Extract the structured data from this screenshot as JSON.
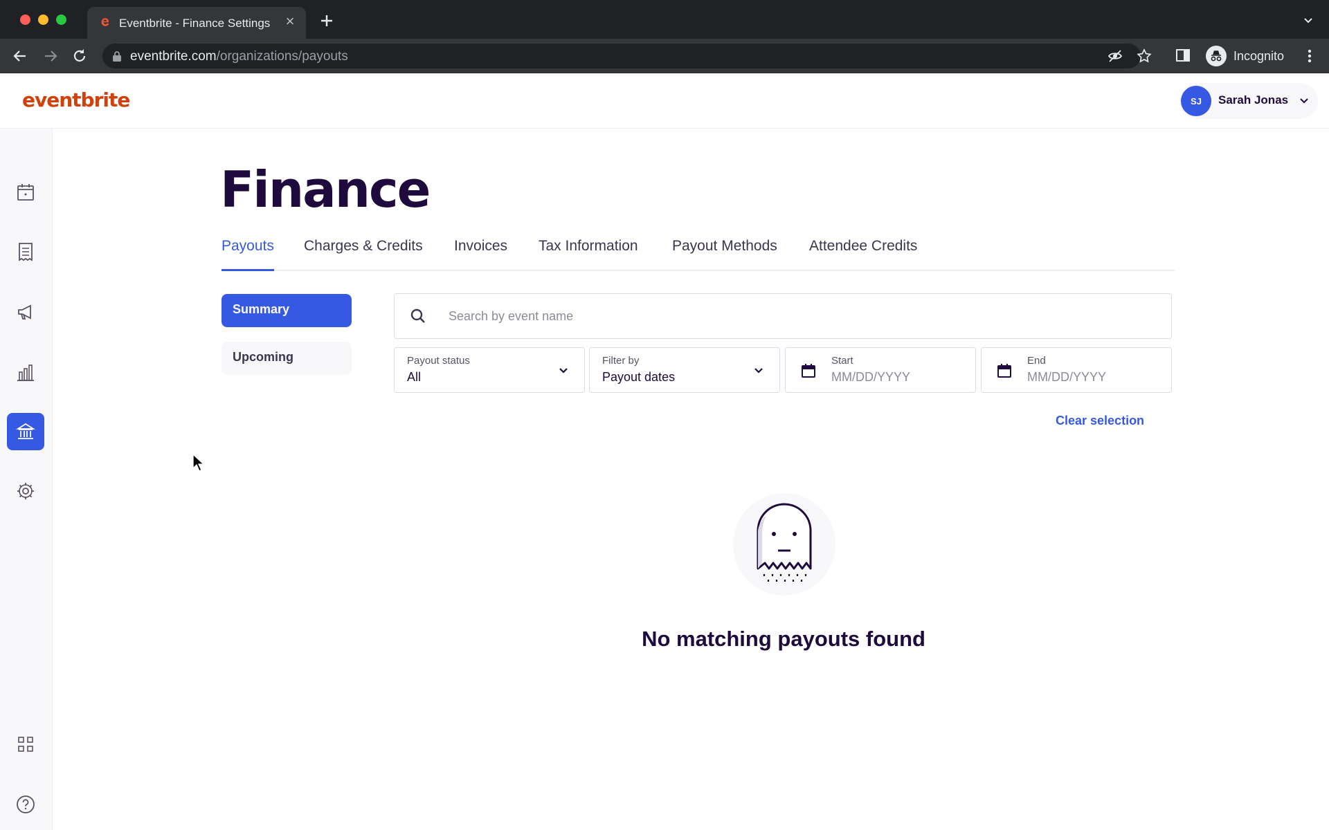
{
  "browser": {
    "tab_title": "Eventbrite - Finance Settings",
    "url_domain": "eventbrite.com",
    "url_path": "/organizations/payouts",
    "profile_label": "Incognito"
  },
  "header": {
    "logo": "eventbrite",
    "user_initials": "SJ",
    "user_name": "Sarah Jonas"
  },
  "sidebar": {
    "items": [
      {
        "icon": "calendar-icon",
        "active": false
      },
      {
        "icon": "orders-list-icon",
        "active": false
      },
      {
        "icon": "megaphone-icon",
        "active": false
      },
      {
        "icon": "bar-chart-icon",
        "active": false
      },
      {
        "icon": "bank-icon",
        "active": true
      },
      {
        "icon": "gear-icon",
        "active": false
      },
      {
        "icon": "apps-grid-icon",
        "active": false
      },
      {
        "icon": "help-icon",
        "active": false
      }
    ]
  },
  "page": {
    "title": "Finance",
    "tabs": [
      "Payouts",
      "Charges & Credits",
      "Invoices",
      "Tax Information",
      "Payout Methods",
      "Attendee Credits"
    ],
    "active_tab": "Payouts",
    "side_nav": [
      "Summary",
      "Upcoming"
    ],
    "search_placeholder": "Search by event name",
    "filters": {
      "payout_status": {
        "label": "Payout status",
        "value": "All"
      },
      "filter_by": {
        "label": "Filter by",
        "value": "Payout dates"
      },
      "start": {
        "label": "Start",
        "placeholder": "MM/DD/YYYY"
      },
      "end": {
        "label": "End",
        "placeholder": "MM/DD/YYYY"
      }
    },
    "clear_label": "Clear selection",
    "empty_message": "No matching payouts found"
  },
  "colors": {
    "brand": "#d1410c",
    "accent": "#3659e3",
    "text": "#1e0a3c"
  }
}
